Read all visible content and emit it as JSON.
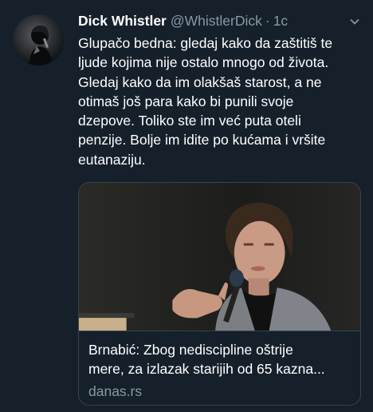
{
  "tweet": {
    "author_name": "Dick Whistler",
    "author_handle": "@WhistlerDick",
    "separator": "·",
    "timestamp": "1c",
    "text": "Glupačo bedna: gledaj kako da zaštitiš te\nljude kojima nije ostalo mnogo od života.\nGledaj kako da im olakšaš starost, a ne\notimaš još para kako bi punili svoje\ndzepove. Toliko ste im već puta oteli\npenzije. Bolje im idite po kućama i vršite\neutanaziju.",
    "more_icon": "chevron-down-icon"
  },
  "link_card": {
    "title": "Brnabić: Zbog nediscipline oštrije\nmere, za izlazak starijih od 65 kazna...",
    "domain": "danas.rs"
  },
  "colors": {
    "background": "#15202b",
    "text_primary": "#ffffff",
    "text_secondary": "#8899a6",
    "border": "#38444d"
  }
}
